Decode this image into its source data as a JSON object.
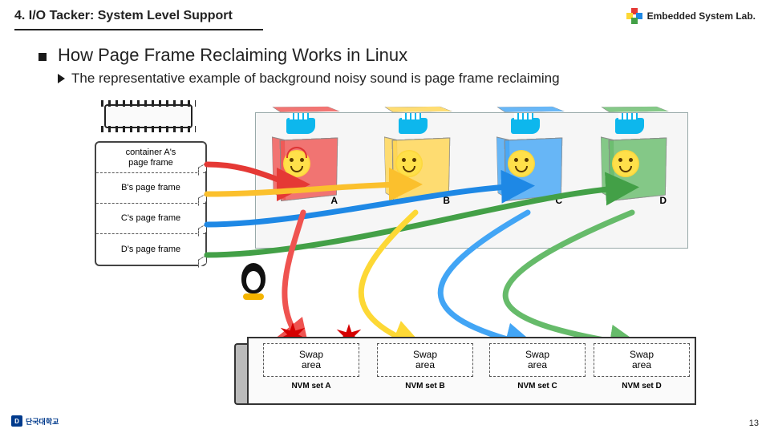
{
  "header": {
    "title": "4. I/O Tacker: System Level Support",
    "lab": "Embedded System Lab."
  },
  "section": {
    "heading": "How Page Frame Reclaiming Works in Linux",
    "sub": "The representative example of background noisy sound is page frame reclaiming"
  },
  "ram": {
    "rows": [
      "container A's\npage frame",
      "B's page frame",
      "C's page frame",
      "D's page frame"
    ]
  },
  "containers": [
    {
      "id": "A"
    },
    {
      "id": "B"
    },
    {
      "id": "C"
    },
    {
      "id": "D"
    }
  ],
  "ssd": {
    "swap_label": "Swap\narea",
    "sets": [
      "NVM set A",
      "NVM set B",
      "NVM set C",
      "NVM set D"
    ]
  },
  "footer": {
    "org": "단국대학교",
    "page": "13"
  }
}
